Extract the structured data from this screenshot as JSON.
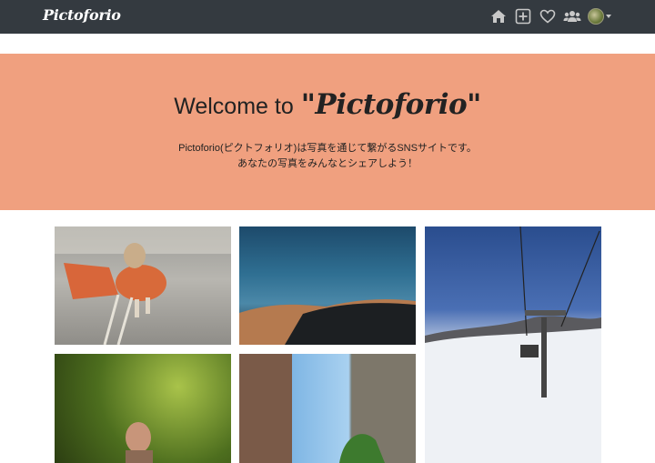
{
  "navbar": {
    "brand": "Pictoforio",
    "icons": [
      "home-icon",
      "add-square-icon",
      "heart-icon",
      "users-icon"
    ],
    "bg_color": "#343a40"
  },
  "hero": {
    "welcome": "Welcome to",
    "logo": "\"Pictoforio\"",
    "subtitle_line1": "Pictoforio(ピクトフォリオ)は写真を通じて繋がるSNSサイトです。",
    "subtitle_line2": "あなたの写真をみんなとシェアしよう！",
    "bg_color": "#f0a07f"
  },
  "photos": [
    "beagle-dog-photo",
    "desert-dune-photo",
    "ski-lift-snow-photo",
    "man-in-forest-photo",
    "narrow-street-photo"
  ]
}
